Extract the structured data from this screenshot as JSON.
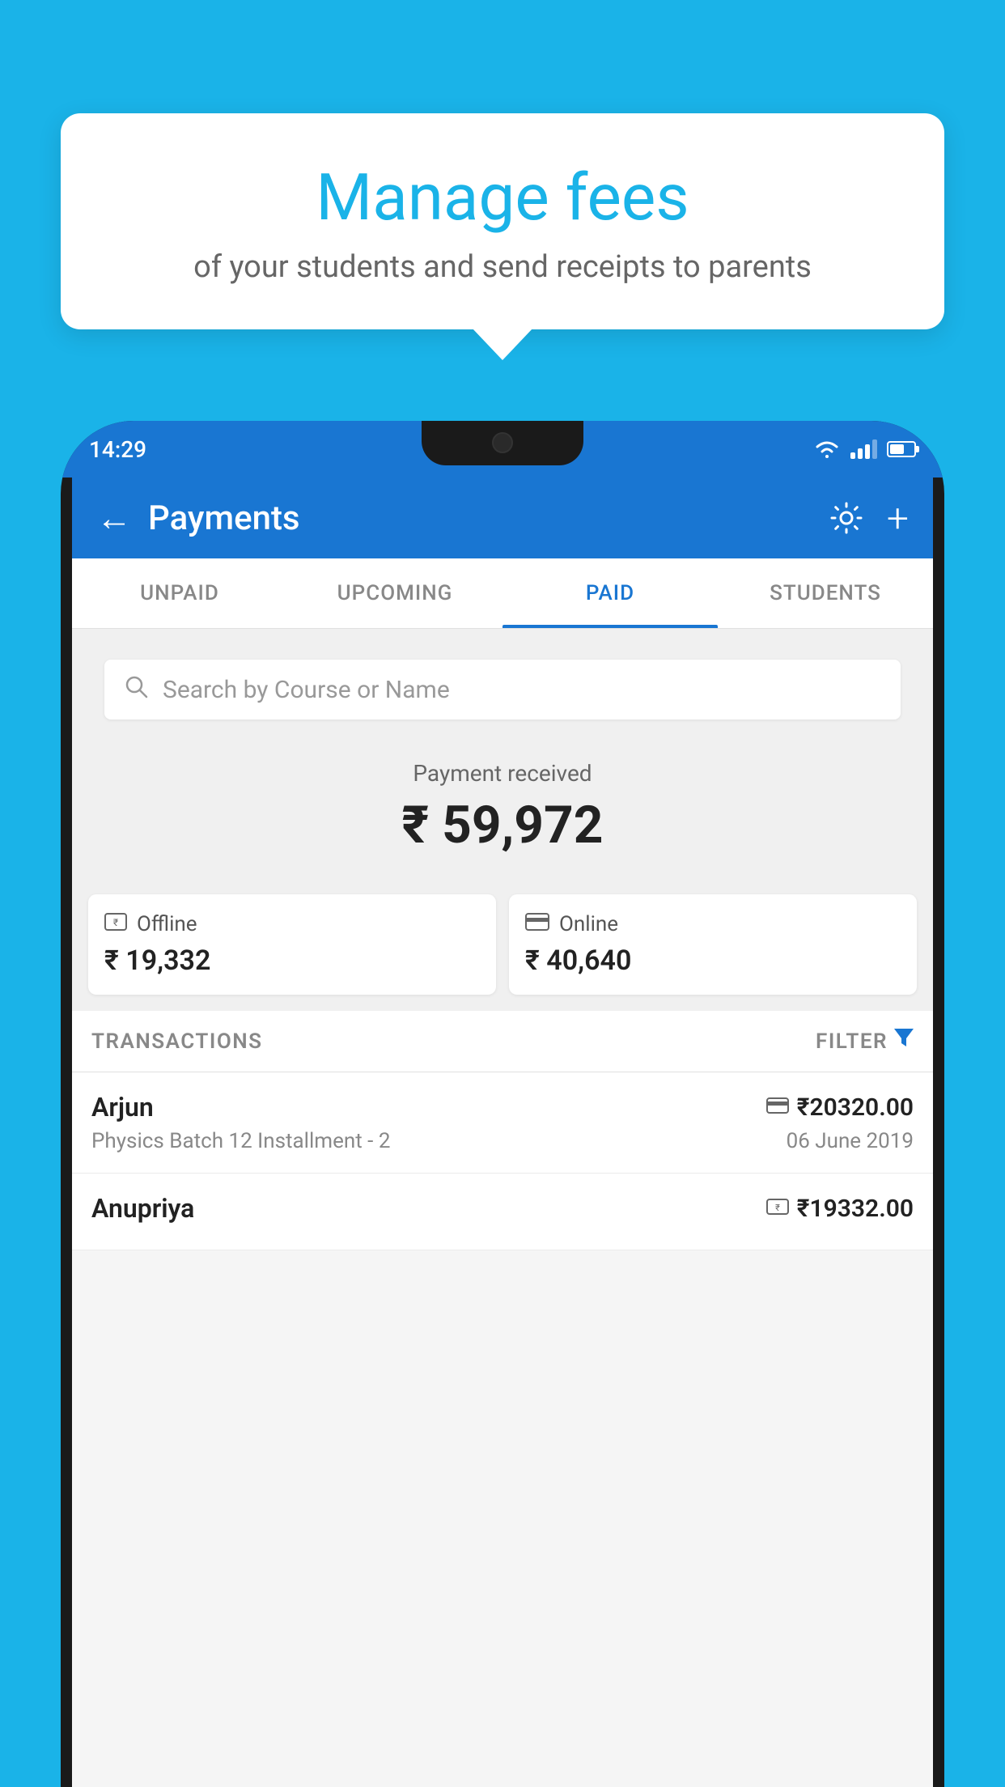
{
  "background": {
    "color": "#1ab3e8"
  },
  "speech_bubble": {
    "title": "Manage fees",
    "subtitle": "of your students and send receipts to parents"
  },
  "status_bar": {
    "time": "14:29"
  },
  "app_header": {
    "title": "Payments",
    "back_label": "←",
    "gear_label": "⚙",
    "plus_label": "+"
  },
  "tabs": [
    {
      "id": "unpaid",
      "label": "UNPAID",
      "active": false
    },
    {
      "id": "upcoming",
      "label": "UPCOMING",
      "active": false
    },
    {
      "id": "paid",
      "label": "PAID",
      "active": true
    },
    {
      "id": "students",
      "label": "STUDENTS",
      "active": false
    }
  ],
  "search": {
    "placeholder": "Search by Course or Name"
  },
  "payment_received": {
    "label": "Payment received",
    "amount": "₹ 59,972"
  },
  "payment_cards": [
    {
      "type": "Offline",
      "amount": "₹ 19,332",
      "icon": "rupee-card"
    },
    {
      "type": "Online",
      "amount": "₹ 40,640",
      "icon": "credit-card"
    }
  ],
  "transactions_section": {
    "label": "TRANSACTIONS",
    "filter_label": "FILTER"
  },
  "transactions": [
    {
      "name": "Arjun",
      "description": "Physics Batch 12 Installment - 2",
      "amount": "₹20320.00",
      "date": "06 June 2019",
      "payment_type": "online"
    },
    {
      "name": "Anupriya",
      "description": "",
      "amount": "₹19332.00",
      "date": "",
      "payment_type": "offline"
    }
  ]
}
